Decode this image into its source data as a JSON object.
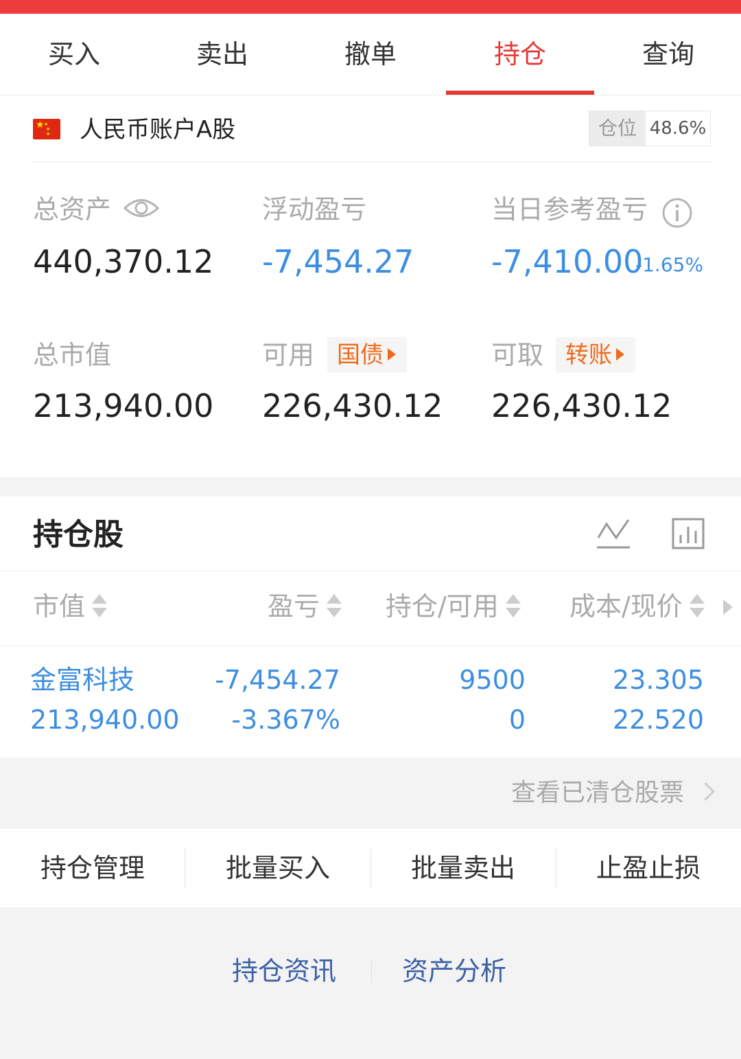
{
  "tabs": [
    {
      "label": "买入"
    },
    {
      "label": "卖出"
    },
    {
      "label": "撤单"
    },
    {
      "label": "持仓",
      "active": true
    },
    {
      "label": "查询"
    }
  ],
  "account": {
    "name": "人民币账户A股",
    "position_label": "仓位",
    "position_value": "48.6%"
  },
  "metrics": {
    "total_assets_label": "总资产",
    "total_assets": "440,370.12",
    "floating_pl_label": "浮动盈亏",
    "floating_pl": "-7,454.27",
    "daily_pl_label": "当日参考盈亏",
    "daily_pl": "-7,410.00",
    "daily_pl_pct": "-1.65%",
    "market_value_label": "总市值",
    "market_value": "213,940.00",
    "available_label": "可用",
    "available_tag": "国债",
    "available": "226,430.12",
    "withdrawable_label": "可取",
    "withdrawable_tag": "转账",
    "withdrawable": "226,430.12"
  },
  "holdings": {
    "title": "持仓股",
    "columns": [
      "市值",
      "盈亏",
      "持仓/可用",
      "成本/现价"
    ],
    "rows": [
      {
        "name": "金富科技",
        "market_value": "213,940.00",
        "pl": "-7,454.27",
        "pl_pct": "-3.367%",
        "holding": "9500",
        "available": "0",
        "cost": "23.305",
        "price": "22.520"
      }
    ]
  },
  "cleared_link": "查看已清仓股票",
  "actions": [
    "持仓管理",
    "批量买入",
    "批量卖出",
    "止盈止损"
  ],
  "footer_links": [
    "持仓资讯",
    "资产分析"
  ],
  "colors": {
    "brand_red": "#e53935",
    "loss_blue": "#3d8ee2",
    "tag_orange": "#f06a1b",
    "link_navy": "#3e60a6"
  }
}
